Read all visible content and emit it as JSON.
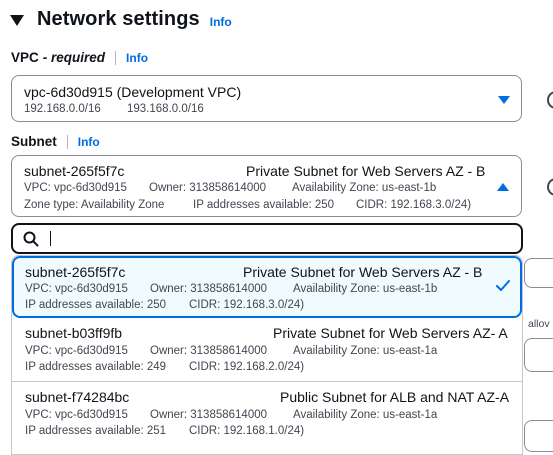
{
  "header": {
    "title": "Network settings",
    "info": "Info"
  },
  "vpc": {
    "label": "VPC",
    "required": "- required",
    "info": "Info",
    "value": "vpc-6d30d915 (Development VPC)",
    "cidr_1": "192.168.0.0/16",
    "cidr_2": "193.168.0.0/16"
  },
  "subnet": {
    "label": "Subnet",
    "info": "Info",
    "selected": {
      "id": "subnet-265f5f7c",
      "name": "Private Subnet for Web Servers AZ - B",
      "vpc": "VPC: vpc-6d30d915",
      "owner": "Owner: 313858614000",
      "az": "Availability Zone: us-east-1b",
      "zone_type": "Zone type: Availability Zone",
      "ips": "IP addresses available: 250",
      "cidr": "CIDR: 192.168.3.0/24)"
    },
    "search": {
      "placeholder": "",
      "value": ""
    },
    "options": [
      {
        "id": "subnet-265f5f7c",
        "name": "Private Subnet for Web Servers AZ - B",
        "vpc": "VPC: vpc-6d30d915",
        "owner": "Owner: 313858614000",
        "az": "Availability Zone: us-east-1b",
        "ips": "IP addresses available: 250",
        "cidr": "CIDR: 192.168.3.0/24)"
      },
      {
        "id": "subnet-b03ff9fb",
        "name": "Private Subnet for Web Servers AZ- A",
        "vpc": "VPC: vpc-6d30d915",
        "owner": "Owner: 313858614000",
        "az": "Availability Zone: us-east-1a",
        "ips": "IP addresses available: 249",
        "cidr": "CIDR: 192.168.2.0/24)"
      },
      {
        "id": "subnet-f74284bc",
        "name": "Public Subnet for ALB and NAT AZ-A",
        "vpc": "VPC: vpc-6d30d915",
        "owner": "Owner: 313858614000",
        "az": "Availability Zone: us-east-1a",
        "ips": "IP addresses available: 251",
        "cidr": "CIDR: 192.168.1.0/24)"
      }
    ]
  },
  "side": {
    "partial_text": "allov"
  },
  "colors": {
    "accent": "#006ce0",
    "text": "#0f141a",
    "muted": "#424650",
    "selected_bg": "#f0fbff"
  }
}
